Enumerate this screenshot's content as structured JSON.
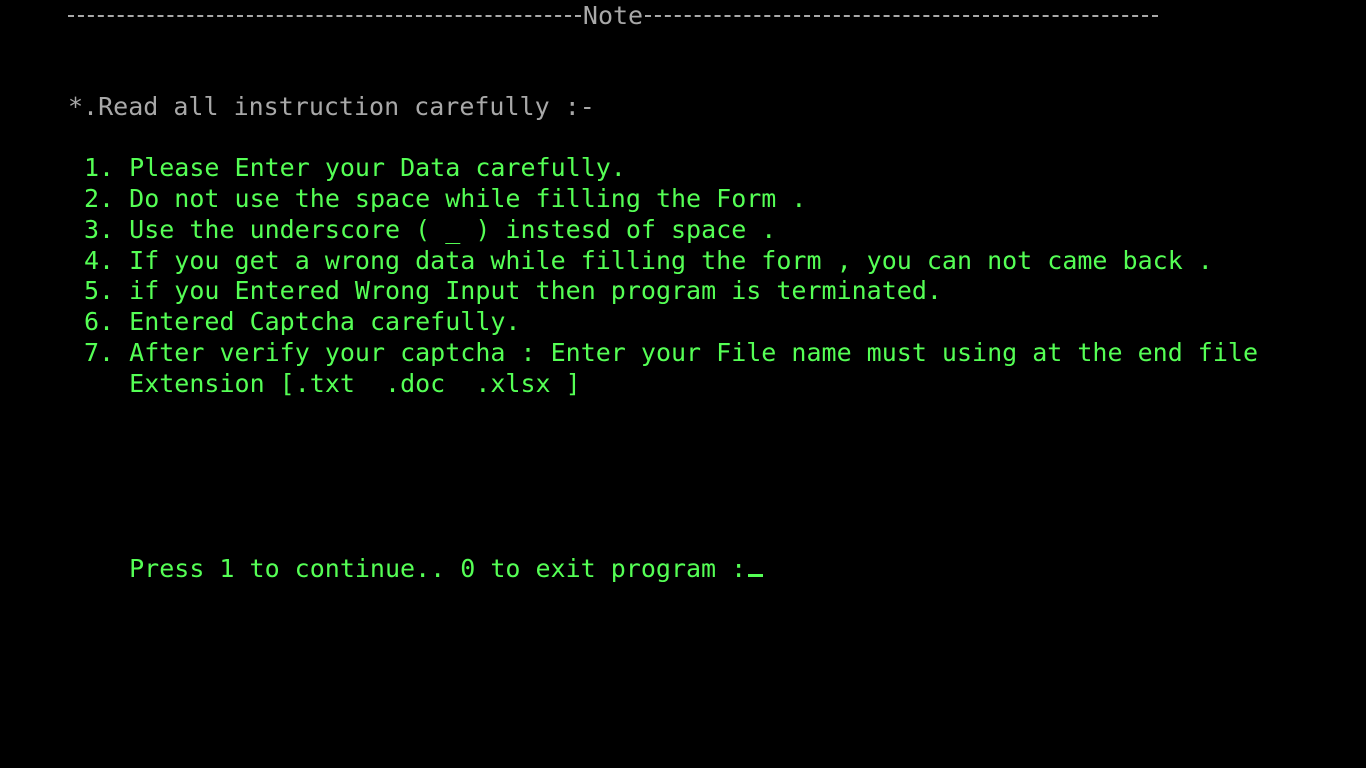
{
  "header": {
    "title": "Note"
  },
  "intro": "*.Read all instruction carefully :-",
  "instructions": [
    "1. Please Enter your Data carefully.",
    "2. Do not use the space while filling the Form .",
    "3. Use the underscore ( _ ) instesd of space .",
    "4. If you get a wrong data while filling the form , you can not came back .",
    "5. if you Entered Wrong Input then program is terminated.",
    "6. Entered Captcha carefully.",
    "7. After verify your captcha : Enter your File name must using at the end file",
    "   Extension [.txt  .doc  .xlsx ]"
  ],
  "prompt": {
    "text": "Press 1 to continue.. 0 to exit program :"
  },
  "colors": {
    "background": "#000000",
    "header_text": "#a8a8a8",
    "intro_text": "#a8a8a8",
    "instruction_text": "#55ff55"
  }
}
